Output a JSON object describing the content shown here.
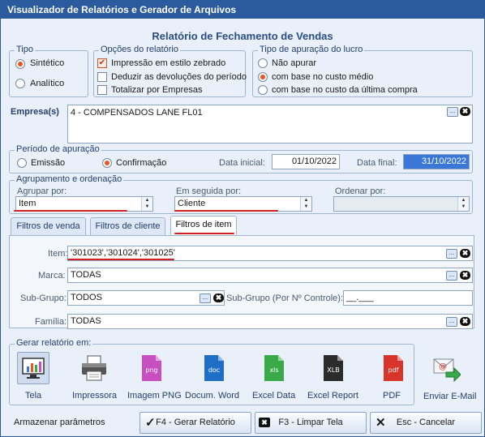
{
  "window": {
    "title": "Visualizador de Relatórios e Gerador de Arquivos"
  },
  "header": {
    "title": "Relatório de Fechamento de Vendas"
  },
  "tipo": {
    "legend": "Tipo",
    "options": [
      "Sintético",
      "Analítico"
    ],
    "selected": 0
  },
  "opcoes": {
    "legend": "Opções do relatório",
    "options": [
      {
        "label": "Impressão em estilo zebrado",
        "checked": true
      },
      {
        "label": "Deduzir as devoluções do período",
        "checked": false
      },
      {
        "label": "Totalizar por Empresas",
        "checked": false
      }
    ]
  },
  "lucro": {
    "legend": "Tipo de apuração do lucro",
    "options": [
      "Não apurar",
      "com base no custo médio",
      "com base no custo da última compra"
    ],
    "selected": 1
  },
  "empresa": {
    "label": "Empresa(s)",
    "value": "4 - COMPENSADOS LANE FL01",
    "dots": "...",
    "clear": "✖"
  },
  "periodo": {
    "legend": "Período de apuração",
    "options": [
      "Emissão",
      "Confirmação"
    ],
    "selected": 1,
    "data_inicial_label": "Data inicial:",
    "data_inicial": "01/10/2022",
    "data_final_label": "Data final:",
    "data_final": "31/10/2022"
  },
  "agrupamento": {
    "legend": "Agrupamento e ordenação",
    "agrupar_label": "Agrupar por:",
    "agrupar_value": "Item",
    "seguida_label": "Em seguida por:",
    "seguida_value": "Cliente",
    "ordenar_label": "Ordenar por:",
    "ordenar_value": ""
  },
  "tabs": [
    {
      "label": "Filtros de venda"
    },
    {
      "label": "Filtros de cliente"
    },
    {
      "label": "Filtros de item"
    }
  ],
  "active_tab": 2,
  "filtros": {
    "item_label": "Item:",
    "item_value": "'301023','301024','301025'",
    "marca_label": "Marca:",
    "marca_value": "TODAS",
    "subgrupo_label": "Sub-Grupo:",
    "subgrupo_value": "TODOS",
    "subgrupo_ctrl_label": "Sub-Grupo (Por Nº Controle):",
    "subgrupo_ctrl_value": "__.___",
    "familia_label": "Família:",
    "familia_value": "TODAS"
  },
  "gerar": {
    "legend": "Gerar relatório em:",
    "outputs": [
      {
        "label": "Tela",
        "icon": "monitor-chart-icon"
      },
      {
        "label": "Impressora",
        "icon": "printer-icon"
      },
      {
        "label": "Imagem PNG",
        "icon": "png-file-icon",
        "badge": "png",
        "color": "#c84fbf"
      },
      {
        "label": "Docum. Word",
        "icon": "word-file-icon",
        "badge": "doc",
        "color": "#1f6fc7"
      },
      {
        "label": "Excel Data",
        "icon": "excel-file-icon",
        "badge": "xls",
        "color": "#3aa94a"
      },
      {
        "label": "Excel Report",
        "icon": "xlb-file-icon",
        "badge": "XLB",
        "color": "#2b2b2b"
      },
      {
        "label": "PDF",
        "icon": "pdf-file-icon",
        "badge": "pdf",
        "color": "#d9342b"
      }
    ],
    "email": {
      "label": "Enviar E-Mail",
      "icon": "email-send-icon"
    }
  },
  "footer": {
    "armazenar": "Armazenar parâmetros",
    "gerar_label": "F4 - Gerar Relatório",
    "limpar_label": "F3 - Limpar Tela",
    "cancelar_label": "Esc - Cancelar"
  },
  "colors": {
    "title_bar": "#2b5b9c",
    "accent": "#e8561b",
    "annotation": "#d32020",
    "selection": "#3a78d8"
  }
}
